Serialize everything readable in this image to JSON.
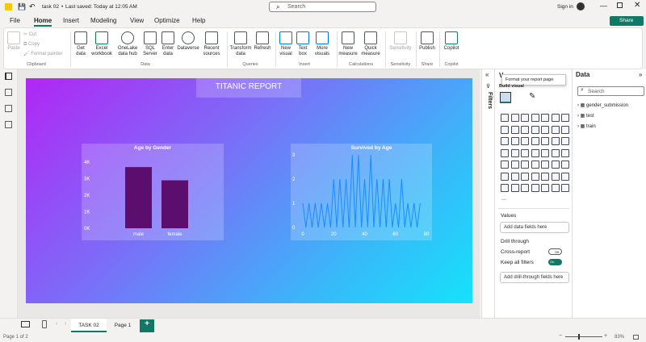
{
  "titlebar": {
    "filename": "task 02",
    "saved_status": "Last saved: Today at 12:05 AM",
    "search_placeholder": "Search",
    "signin": "Sign in",
    "share": "Share"
  },
  "menu": [
    "File",
    "Home",
    "Insert",
    "Modeling",
    "View",
    "Optimize",
    "Help"
  ],
  "ribbon": {
    "clipboard": {
      "paste": "Paste",
      "cut": "Cut",
      "copy": "Copy",
      "format_painter": "Format painter",
      "group": "Clipboard"
    },
    "data": {
      "get_data": "Get data",
      "excel": "Excel workbook",
      "onelake": "OneLake data hub",
      "sql": "SQL Server",
      "enter": "Enter data",
      "dataverse": "Dataverse",
      "recent": "Recent sources",
      "group": "Data"
    },
    "queries": {
      "transform": "Transform data",
      "refresh": "Refresh",
      "group": "Queries"
    },
    "insert": {
      "new_visual": "New visual",
      "text_box": "Text box",
      "more_visuals": "More visuals",
      "group": "Insert"
    },
    "calculations": {
      "new_measure": "New measure",
      "quick_measure": "Quick measure",
      "group": "Calculations"
    },
    "sensitivity": {
      "label": "Sensitivity",
      "group": "Sensitivity"
    },
    "share": {
      "publish": "Publish",
      "group": "Share"
    },
    "copilot": {
      "label": "Copilot",
      "group": "Copilot"
    }
  },
  "report": {
    "title": "TITANIC REPORT"
  },
  "chart1": {
    "title": "Age by Gender"
  },
  "chart2": {
    "title": "Survived by Age"
  },
  "chart_data": [
    {
      "type": "bar",
      "title": "Age by Gender",
      "categories": [
        "male",
        "female"
      ],
      "values": [
        3700,
        2900
      ],
      "yticks": [
        "4K",
        "3K",
        "2K",
        "1K",
        "0K"
      ],
      "ylim": [
        0,
        4000
      ],
      "color": "#5b0e6e"
    },
    {
      "type": "line",
      "title": "Survived by Age",
      "xticks": [
        "0",
        "20",
        "40",
        "60",
        "80"
      ],
      "yticks": [
        "3",
        "2",
        "1",
        "0"
      ],
      "xlim": [
        0,
        80
      ],
      "ylim": [
        0,
        3
      ],
      "color": "#1a8cff",
      "x": [
        0,
        2,
        4,
        6,
        8,
        10,
        12,
        14,
        16,
        18,
        20,
        22,
        24,
        26,
        28,
        30,
        32,
        34,
        36,
        38,
        40,
        42,
        44,
        46,
        48,
        50,
        52,
        54,
        56,
        58,
        60,
        62,
        64,
        66,
        68,
        70,
        72,
        74,
        76
      ],
      "y": [
        1,
        0,
        1,
        0,
        1,
        0,
        1,
        0,
        1,
        0,
        2,
        0,
        2,
        0,
        2,
        0,
        3,
        0,
        3,
        0,
        2,
        0,
        3,
        0,
        2,
        0,
        2,
        0,
        2,
        0,
        1,
        0,
        2,
        0,
        1,
        0,
        1,
        0,
        1
      ]
    }
  ],
  "filters_label": "Filters",
  "viz": {
    "title": "V",
    "tooltip": "Format your report page",
    "build_visual": "Build visual",
    "values_label": "Values",
    "values_field": "Add data fields here",
    "drill": "Drill through",
    "cross_report": "Cross-report",
    "cross_toggle": "Off",
    "keep_filters": "Keep all filters",
    "keep_toggle": "On",
    "drill_field": "Add drill-through fields here",
    "more": "..."
  },
  "data_pane": {
    "title": "Data",
    "search_placeholder": "Search",
    "tables": [
      "gender_submission",
      "test",
      "train"
    ]
  },
  "tabs": {
    "active": "TASK 02",
    "other": "Page 1",
    "add": "+"
  },
  "status": {
    "page": "Page 1 of 2",
    "zoom": "83%"
  }
}
